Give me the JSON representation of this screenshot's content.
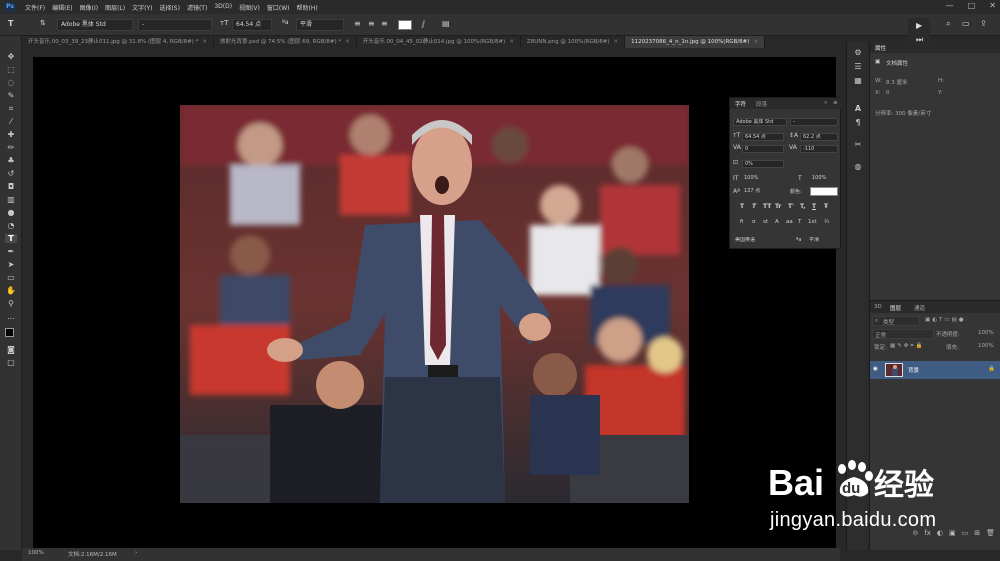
{
  "menubar": {
    "logo": "Ps",
    "menus": [
      "文件(F)",
      "编辑(E)",
      "图像(I)",
      "图层(L)",
      "文字(Y)",
      "选择(S)",
      "滤镜(T)",
      "3D(D)",
      "视图(V)",
      "窗口(W)",
      "帮助(H)"
    ],
    "window_controls": [
      "—",
      "□",
      "✕"
    ]
  },
  "options": {
    "tool_glyph": "T",
    "font_family": "Adobe 黑体 Std",
    "font_style": "-",
    "font_size": "64.54 点",
    "antialias": "平滑",
    "color": "#ffffff"
  },
  "tabs": [
    {
      "label": "开头音乐.00_03_39_23静止011.jpg @ 31.8% (图层 4, RGB/8#) *",
      "active": false
    },
    {
      "label": "放射光背景.psd @ 74.5% (图层 69, RGB/8#) *",
      "active": false
    },
    {
      "label": "开头音乐.00_04_45_02静止014.jpg @ 100%(RGB/8#)",
      "active": false
    },
    {
      "label": "Z8UNN.png @ 100%(RGB/8#)",
      "active": false
    },
    {
      "label": "1120237086_4_n_1n.jpg @ 100%(RGB/8#)",
      "active": true
    }
  ],
  "status": {
    "zoom": "100%",
    "doc": "文档:2.16M/2.16M"
  },
  "character_panel": {
    "tab_character": "字符",
    "tab_paragraph": "段落",
    "font_family": "Adobe 黑体 Std",
    "font_style": "-",
    "size": "64.54 点",
    "leading": "62.2 点",
    "kerning": "0",
    "tracking": "-110",
    "tsume": "0%",
    "vscale": "100%",
    "hscale": "100%",
    "baseline": "137 点",
    "color_label": "颜色:",
    "color": "#ffffff",
    "styles": [
      "T",
      "T",
      "TT",
      "Tr",
      "T'",
      "T,",
      "T",
      "Ŧ"
    ],
    "extras": [
      "fi",
      "σ",
      "st",
      "A",
      "aa",
      "T",
      "1st",
      "½"
    ],
    "language": "美国英语",
    "aa_method": "平滑"
  },
  "properties_panel": {
    "title": "属性",
    "subtitle": "文档属性",
    "w_label": "W:",
    "w_value": "8.3 厘米",
    "h_label": "H:",
    "x_label": "X:",
    "x_value": "0",
    "y_label": "Y:",
    "resolution": "分辨率: 300 像素/英寸"
  },
  "layers_panel": {
    "tabs": [
      "3D",
      "图层",
      "通道"
    ],
    "filter": "类型",
    "blend": "正常",
    "opacity_label": "不透明度:",
    "opacity": "100%",
    "lock_label": "锁定:",
    "fill_label": "填充:",
    "fill": "100%",
    "layer_name": "背景",
    "footer_icons": [
      "⊝",
      "fx",
      "◐",
      "▣",
      "▭",
      "⊞",
      "🗑"
    ]
  },
  "watermark": {
    "brand": "Bai",
    "brand2": "du",
    "brand3": "经验",
    "url": "jingyan.baidu.com"
  }
}
